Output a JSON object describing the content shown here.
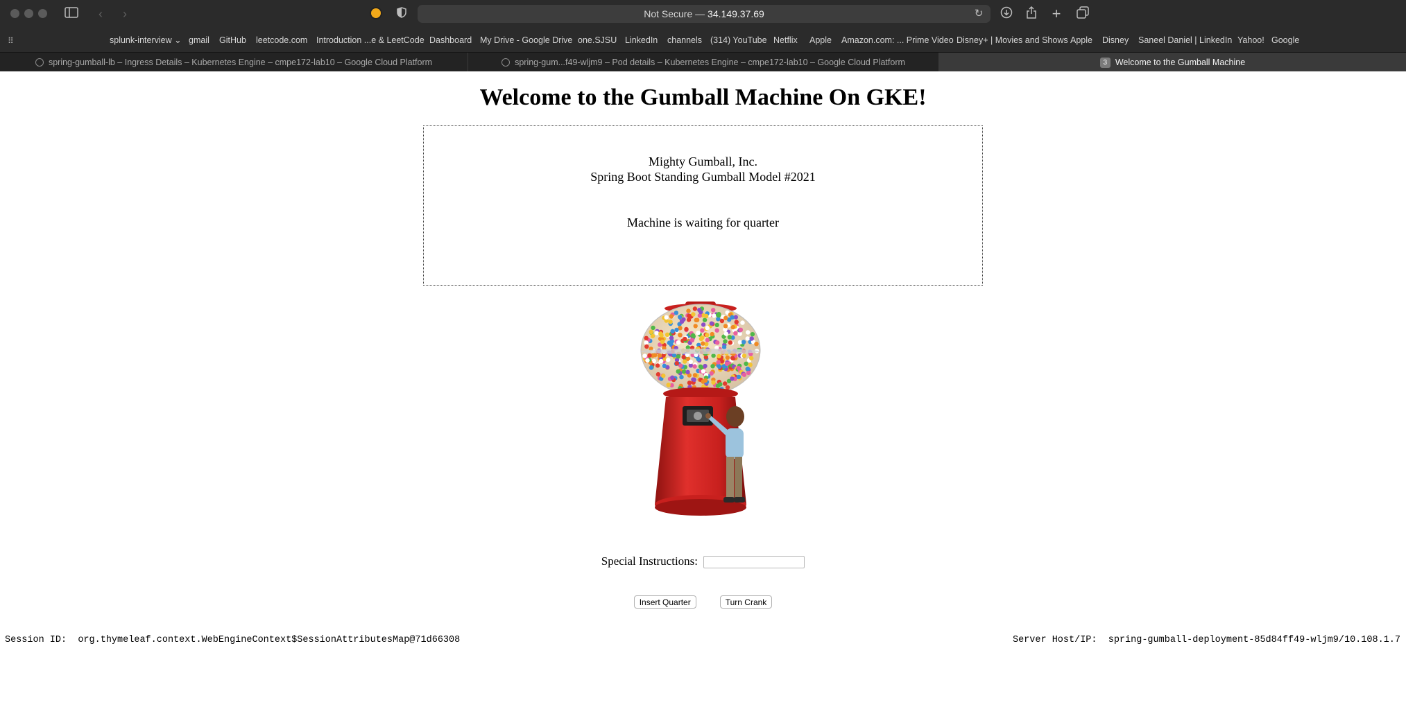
{
  "browser": {
    "address": {
      "security": "Not Secure",
      "separator": " — ",
      "host": "34.149.37.69"
    },
    "bookmarks": [
      "splunk-interview",
      "gmail",
      "GitHub",
      "leetcode.com",
      "Introduction ...e & LeetCode",
      "Dashboard",
      "My Drive - Google Drive",
      "one.SJSU",
      "LinkedIn",
      "channels",
      "(314) YouTube",
      "Netflix",
      "Apple",
      "Amazon.com: ... Prime Video",
      "Disney+ | Movies and Shows",
      "Apple",
      "Disney",
      "Saneel Daniel | LinkedIn",
      "Yahoo!",
      "Google"
    ],
    "bookmark_folder_chevron": "⌄",
    "tabs": [
      {
        "label": "spring-gumball-lb – Ingress Details – Kubernetes Engine – cmpe172-lab10 – Google Cloud Platform"
      },
      {
        "label": "spring-gum...f49-wljm9 – Pod details – Kubernetes Engine – cmpe172-lab10 – Google Cloud Platform"
      },
      {
        "label": "Welcome to the Gumball Machine",
        "badge": "3"
      }
    ]
  },
  "page": {
    "title": "Welcome to the Gumball Machine On GKE!",
    "company": "Mighty Gumball, Inc.",
    "model": "Spring Boot Standing Gumball Model #2021",
    "status": "Machine is waiting for quarter",
    "instructions_label": "Special Instructions:",
    "instructions_value": "",
    "insert_quarter_label": "Insert Quarter",
    "turn_crank_label": "Turn Crank"
  },
  "footer": {
    "session_label": "Session ID:",
    "session_value": "org.thymeleaf.context.WebEngineContext$SessionAttributesMap@71d66308",
    "server_label": "Server Host/IP:",
    "server_value": "spring-gumball-deployment-85d84ff49-wljm9/10.108.1.7"
  },
  "colors": {
    "chrome_bg": "#2b2b2b",
    "tab_active": "#3a3a3a",
    "machine_red": "#c8201e"
  }
}
